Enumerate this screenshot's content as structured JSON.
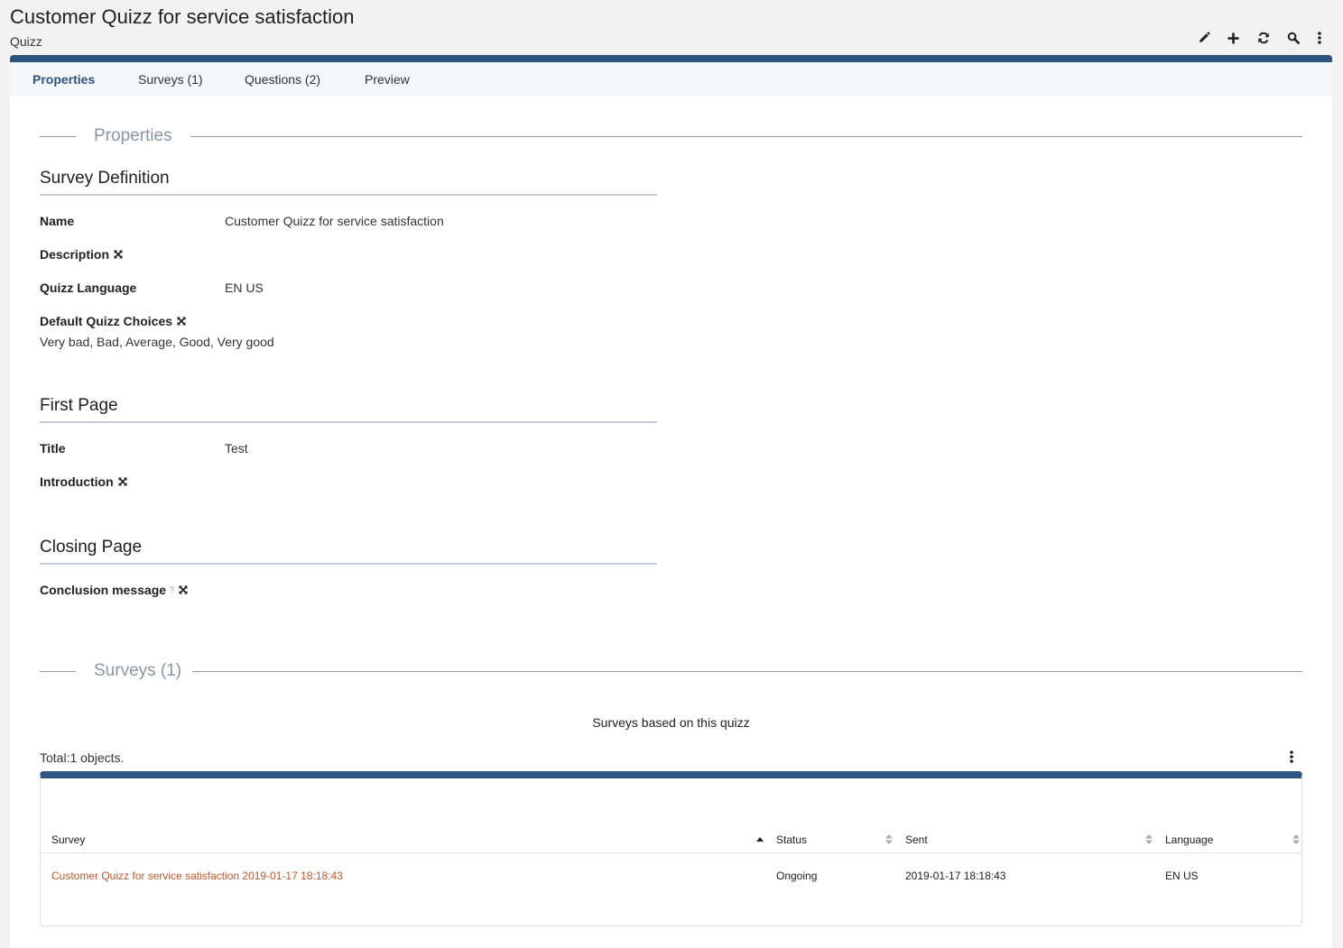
{
  "header": {
    "title": "Customer Quizz for service satisfaction",
    "subtitle": "Quizz",
    "toolbar": [
      {
        "icon": "pencil-icon",
        "name": "edit-button"
      },
      {
        "icon": "plus-icon",
        "name": "add-button"
      },
      {
        "icon": "refresh-icon",
        "name": "refresh-button"
      },
      {
        "icon": "search-icon",
        "name": "search-button"
      },
      {
        "icon": "kebab-menu-icon",
        "name": "more-menu-button"
      }
    ]
  },
  "tabs": [
    {
      "label": "Properties",
      "active": true
    },
    {
      "label": "Surveys (1)"
    },
    {
      "label": "Questions (2)"
    },
    {
      "label": "Preview"
    }
  ],
  "properties": {
    "section_label": "Properties",
    "survey_definition": {
      "title": "Survey Definition",
      "name_label": "Name",
      "name_value": "Customer Quizz for service satisfaction",
      "description_label": "Description",
      "language_label": "Quizz Language",
      "language_value": "EN US",
      "choices_label": "Default Quizz Choices",
      "choices_value": "Very bad, Bad, Average, Good, Very good"
    },
    "first_page": {
      "title": "First Page",
      "title_label": "Title",
      "title_value": "Test",
      "introduction_label": "Introduction"
    },
    "closing_page": {
      "title": "Closing Page",
      "conclusion_label": "Conclusion message",
      "help_mark": "?"
    }
  },
  "surveys": {
    "section_label": "Surveys (1)",
    "caption": "Surveys based on this quizz",
    "total": "Total:1 objects.",
    "columns": [
      "Survey",
      "Status",
      "Sent",
      "Language"
    ],
    "rows": [
      {
        "survey": "Customer Quizz for service satisfaction 2019-01-17 18:18:43",
        "status": "Ongoing",
        "sent": "2019-01-17 18:18:43",
        "language": "EN US"
      }
    ]
  },
  "colors": {
    "accent": "#2e5482",
    "link": "#c0592a",
    "section_label": "#8a96a3"
  }
}
